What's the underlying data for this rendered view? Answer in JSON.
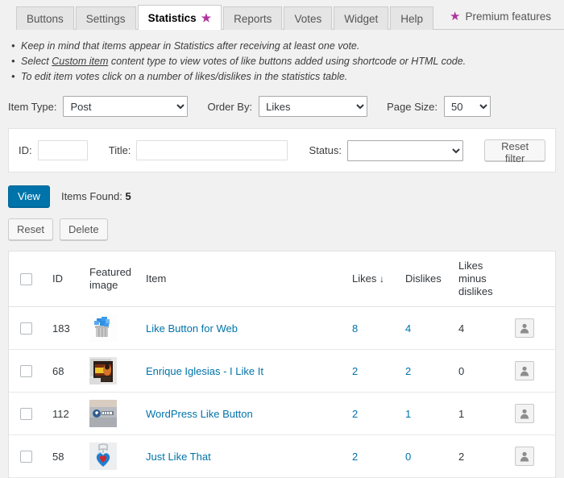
{
  "tabs": [
    {
      "label": "Buttons",
      "active": false,
      "star": false
    },
    {
      "label": "Settings",
      "active": false,
      "star": false
    },
    {
      "label": "Statistics",
      "active": true,
      "star": true
    },
    {
      "label": "Reports",
      "active": false,
      "star": false
    },
    {
      "label": "Votes",
      "active": false,
      "star": false
    },
    {
      "label": "Widget",
      "active": false,
      "star": false
    },
    {
      "label": "Help",
      "active": false,
      "star": false
    }
  ],
  "premium": {
    "label": "Premium features",
    "star_icon": "star-icon",
    "star_color": "#b0359c"
  },
  "notes": [
    {
      "pre": "Keep in mind that items appear in Statistics after receiving at least one vote.",
      "link": "",
      "post": ""
    },
    {
      "pre": "Select ",
      "link": "Custom item",
      "post": " content type to view votes of like buttons added using shortcode or HTML code."
    },
    {
      "pre": "To edit item votes click on a number of likes/dislikes in the statistics table.",
      "link": "",
      "post": ""
    }
  ],
  "selectors": {
    "item_type_label": "Item Type:",
    "item_type_value": "Post",
    "item_type_options": [
      "Post"
    ],
    "order_by_label": "Order By:",
    "order_by_value": "Likes",
    "order_by_options": [
      "Likes"
    ],
    "page_size_label": "Page Size:",
    "page_size_value": "50",
    "page_size_options": [
      "50"
    ]
  },
  "filter": {
    "id_label": "ID:",
    "id_value": "",
    "id_placeholder": "",
    "title_label": "Title:",
    "title_value": "",
    "title_placeholder": "",
    "status_label": "Status:",
    "status_value": "",
    "status_options": [
      ""
    ],
    "reset_filter_label": "Reset filter"
  },
  "viewrow": {
    "view_label": "View",
    "items_found_label": "Items Found:",
    "items_found_count": "5"
  },
  "actions": {
    "reset_label": "Reset",
    "delete_label": "Delete"
  },
  "table": {
    "headers": {
      "select_all": "",
      "id": "ID",
      "featured_image": "Featured image",
      "item": "Item",
      "likes": "Likes",
      "likes_sort_arrow": "↓",
      "dislikes": "Dislikes",
      "likes_minus_dislikes": "Likes minus dislikes"
    },
    "rows": [
      {
        "id": "183",
        "title": "Like Button for Web",
        "likes": "8",
        "dislikes": "4",
        "diff": "4",
        "thumb": "like-button-for-web-thumbnail",
        "user_icon": "user-avatar-icon"
      },
      {
        "id": "68",
        "title": "Enrique Iglesias - I Like It",
        "likes": "2",
        "dislikes": "2",
        "diff": "0",
        "thumb": "enrique-iglesias-thumbnail",
        "user_icon": "user-avatar-icon"
      },
      {
        "id": "112",
        "title": "WordPress Like Button",
        "likes": "2",
        "dislikes": "1",
        "diff": "1",
        "thumb": "wordpress-like-button-thumbnail",
        "user_icon": "user-avatar-icon"
      },
      {
        "id": "58",
        "title": "Just Like That",
        "likes": "2",
        "dislikes": "0",
        "diff": "2",
        "thumb": "just-like-that-thumbnail",
        "user_icon": "user-avatar-icon"
      }
    ]
  },
  "colors": {
    "link": "#0073aa",
    "primary_button": "#0073aa",
    "accent_star": "#b0359c",
    "page_bg": "#f1f1f1"
  }
}
